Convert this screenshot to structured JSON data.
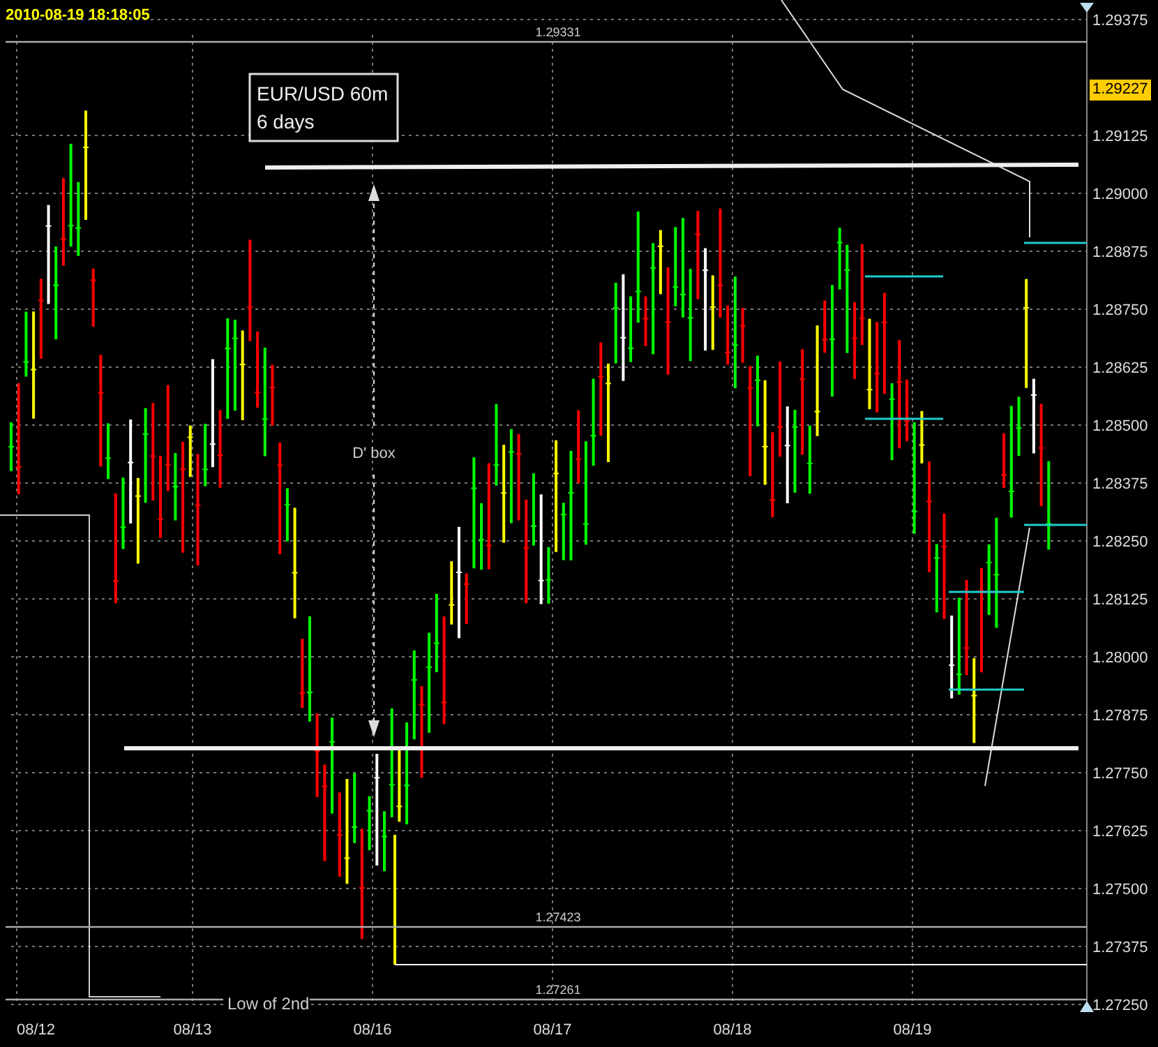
{
  "timestamp": "2010-08-19  18:18:05",
  "info_box": [
    "EUR/USD 60m",
    "6 days"
  ],
  "current_price": "1.29227",
  "price_axis": [
    "1.29375",
    "1.29125",
    "1.29000",
    "1.28875",
    "1.28750",
    "1.28625",
    "1.28500",
    "1.28375",
    "1.28250",
    "1.28125",
    "1.28000",
    "1.27875",
    "1.27750",
    "1.27625",
    "1.27500",
    "1.27375",
    "1.27250"
  ],
  "date_axis": [
    "08/12",
    "08/13",
    "08/16",
    "08/17",
    "08/18",
    "08/19"
  ],
  "annotations": [
    {
      "kind": "level",
      "text": "1.29331"
    },
    {
      "kind": "arrow",
      "text": "D' box"
    },
    {
      "kind": "level",
      "text": "1.27423"
    },
    {
      "kind": "level",
      "text": "1.27261"
    },
    {
      "kind": "note",
      "text": "Low of 2nd"
    }
  ]
}
